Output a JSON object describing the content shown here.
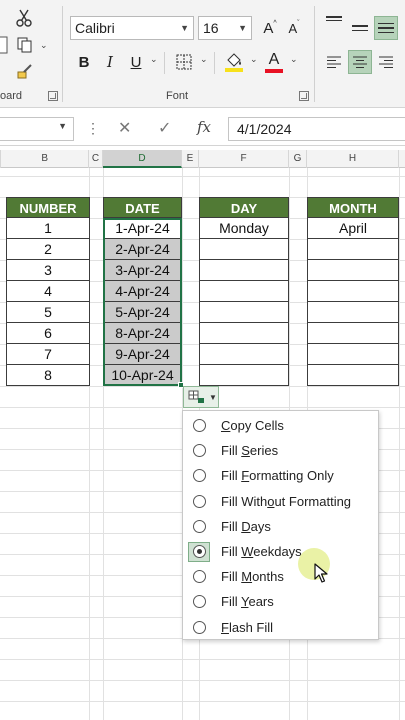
{
  "ribbon": {
    "font_name": "Calibri",
    "font_size": "16",
    "clipboard_group_label": "oard",
    "font_group_label": "Font",
    "icons": [
      "cut-icon",
      "copy-icon",
      "format-painter-icon",
      "increase-font-icon",
      "decrease-font-icon",
      "bold-icon",
      "italic-icon",
      "underline-icon",
      "borders-icon",
      "fill-color-icon",
      "font-color-icon",
      "align-top-icon",
      "align-middle-icon",
      "align-bottom-icon",
      "align-left-icon",
      "align-center-icon",
      "align-right-icon"
    ],
    "bold": "B",
    "italic": "I",
    "underline": "U",
    "grow_font": "A",
    "shrink_font": "A",
    "font_color_glyph": "A",
    "colors": {
      "fill_color": "#f7e11b",
      "font_color": "#e81123",
      "selected_button": "#b6d3ba"
    }
  },
  "formula_bar": {
    "name_box": "",
    "formula": "4/1/2024",
    "cancel": "✕",
    "enter": "✓",
    "fx": "fx"
  },
  "columns": [
    "B",
    "C",
    "D",
    "E",
    "F",
    "G",
    "H"
  ],
  "active_column": "D",
  "table": {
    "headers": {
      "number": "NUMBER",
      "date": "DATE",
      "day": "DAY",
      "month": "MONTH"
    },
    "numbers": [
      "1",
      "2",
      "3",
      "4",
      "5",
      "6",
      "7",
      "8"
    ],
    "dates": [
      "1-Apr-24",
      "2-Apr-24",
      "3-Apr-24",
      "4-Apr-24",
      "5-Apr-24",
      "8-Apr-24",
      "9-Apr-24",
      "10-Apr-24"
    ],
    "day_first": "Monday",
    "month_first": "April",
    "header_color": "#517a35"
  },
  "autofill_menu": {
    "options": [
      {
        "before": "",
        "key": "C",
        "after": "opy Cells",
        "selected": false
      },
      {
        "before": "Fill ",
        "key": "S",
        "after": "eries",
        "selected": false
      },
      {
        "before": "Fill ",
        "key": "F",
        "after": "ormatting Only",
        "selected": false
      },
      {
        "before": "Fill With",
        "key": "o",
        "after": "ut Formatting",
        "selected": false
      },
      {
        "before": "Fill ",
        "key": "D",
        "after": "ays",
        "selected": false
      },
      {
        "before": "Fill ",
        "key": "W",
        "after": "eekdays",
        "selected": true
      },
      {
        "before": "Fill ",
        "key": "M",
        "after": "onths",
        "selected": false
      },
      {
        "before": "Fill ",
        "key": "Y",
        "after": "ears",
        "selected": false
      },
      {
        "before": "",
        "key": "F",
        "after": "lash Fill",
        "selected": false
      }
    ],
    "selected_option": "Fill Weekdays"
  }
}
